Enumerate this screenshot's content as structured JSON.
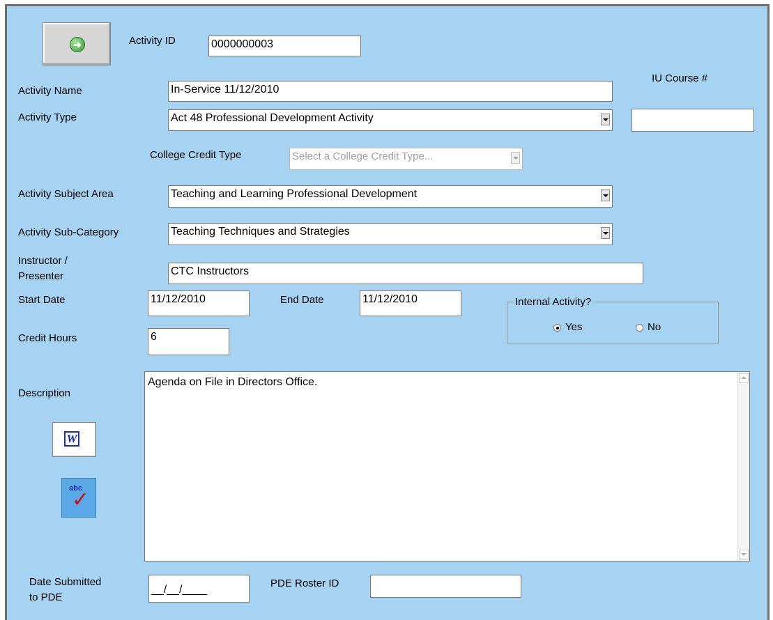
{
  "form": {
    "activity_id_label": "Activity ID",
    "activity_id_value": "0000000003",
    "iu_course_label": "IU Course #",
    "iu_course_value": "",
    "activity_name_label": "Activity Name",
    "activity_name_value": "In-Service 11/12/2010",
    "activity_type_label": "Activity Type",
    "activity_type_value": "Act 48 Professional Development Activity",
    "college_credit_type_label": "College Credit Type",
    "college_credit_type_value": "Select a College Credit Type...",
    "subject_area_label": "Activity Subject Area",
    "subject_area_value": "Teaching and Learning Professional Development",
    "sub_category_label": "Activity Sub-Category",
    "sub_category_value": "Teaching Techniques and Strategies",
    "instructor_label_line1": "Instructor /",
    "instructor_label_line2": "Presenter",
    "instructor_value": "CTC Instructors",
    "start_date_label": "Start Date",
    "start_date_value": "11/12/2010",
    "end_date_label": "End Date",
    "end_date_value": "11/12/2010",
    "internal_activity_label": "Internal Activity?",
    "internal_yes_label": "Yes",
    "internal_no_label": "No",
    "internal_selected": "Yes",
    "credit_hours_label": "Credit Hours",
    "credit_hours_value": "6",
    "description_label": "Description",
    "description_value": "Agenda on File in Directors Office.",
    "date_submitted_label_line1": "Date Submitted",
    "date_submitted_label_line2": "to PDE",
    "date_submitted_value": "__/__/____",
    "pde_roster_label": "PDE Roster ID",
    "pde_roster_value": ""
  },
  "icons": {
    "go": "green-arrow-icon",
    "word": "word-icon",
    "spellcheck": "spellcheck-icon",
    "word_letter": "W",
    "spellcheck_text": "abc"
  },
  "colors": {
    "form_background": "#a6d3f1",
    "field_background": "#ffffff",
    "disabled_text": "#a0a0a0"
  }
}
